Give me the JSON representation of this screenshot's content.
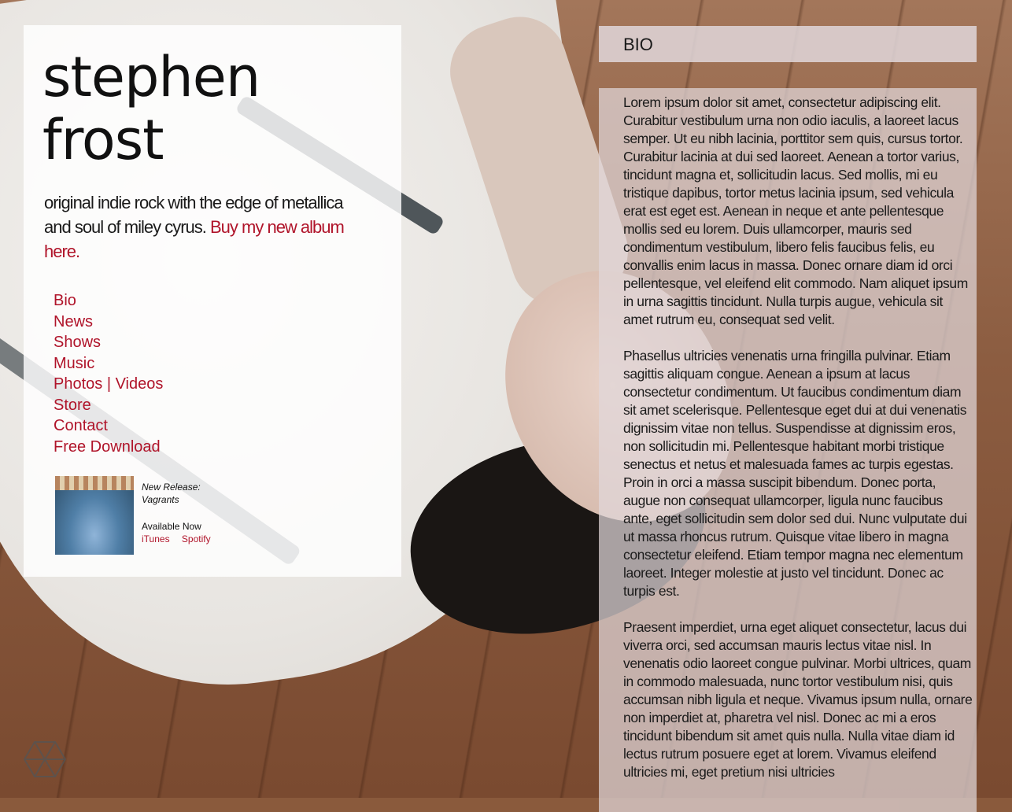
{
  "artist": {
    "name_line1": "stephen",
    "name_line2": "frost"
  },
  "tagline": {
    "text": "original indie rock with the edge of metallica and soul of miley cyrus.",
    "link": "Buy my new album here."
  },
  "nav": [
    "Bio",
    "News",
    "Shows",
    "Music",
    "Photos | Videos",
    "Store",
    "Contact",
    "Free Download"
  ],
  "release": {
    "label": "New Release:",
    "title": "Vagrants",
    "availability": "Available Now",
    "links": [
      "iTunes",
      "Spotify"
    ]
  },
  "bio": {
    "heading": "BIO",
    "paragraphs": [
      "Lorem ipsum dolor sit amet, consectetur adipiscing elit. Curabitur vestibulum urna non odio iaculis, a laoreet lacus semper. Ut eu nibh lacinia, porttitor sem quis, cursus tortor. Curabitur lacinia at dui sed laoreet. Aenean a tortor varius, tincidunt magna et, sollicitudin lacus. Sed mollis, mi eu tristique dapibus, tortor metus lacinia ipsum, sed vehicula erat est eget est. Aenean in neque et ante pellentesque mollis sed eu lorem. Duis ullamcorper, mauris sed condimentum vestibulum, libero felis faucibus felis, eu convallis enim lacus in massa. Donec ornare diam id orci pellentesque, vel eleifend elit commodo. Nam aliquet ipsum in urna sagittis tincidunt. Nulla turpis augue, vehicula sit amet rutrum eu, consequat sed velit.",
      "Phasellus ultricies venenatis urna fringilla pulvinar. Etiam sagittis aliquam congue. Aenean a ipsum at lacus consectetur condimentum. Ut faucibus condimentum diam sit amet scelerisque. Pellentesque eget dui at dui venenatis dignissim vitae non tellus. Suspendisse at dignissim eros, non sollicitudin mi. Pellentesque habitant morbi tristique senectus et netus et malesuada fames ac turpis egestas. Proin in orci a massa suscipit bibendum. Donec porta, augue non consequat ullamcorper, ligula nunc faucibus ante, eget sollicitudin sem dolor sed dui. Nunc vulputate dui ut massa rhoncus rutrum. Quisque vitae libero in magna consectetur eleifend. Etiam tempor magna nec elementum laoreet. Integer molestie at justo vel tincidunt. Donec ac turpis est.",
      "Praesent imperdiet, urna eget aliquet consectetur, lacus dui viverra orci, sed accumsan mauris lectus vitae nisl. In venenatis odio laoreet congue pulvinar. Morbi ultrices, quam in commodo malesuada, nunc tortor vestibulum nisi, quis accumsan nibh ligula et neque. Vivamus ipsum nulla, ornare non imperdiet at, pharetra vel nisl. Donec ac mi a eros tincidunt bibendum sit amet quis nulla. Nulla vitae diam id lectus rutrum posuere eget at lorem. Vivamus eleifend ultricies mi, eget pretium nisi ultricies"
    ]
  },
  "colors": {
    "accent": "#b0142a",
    "text": "#1a1a1a"
  },
  "icons": {
    "logo": "hexagon-logo-icon"
  }
}
